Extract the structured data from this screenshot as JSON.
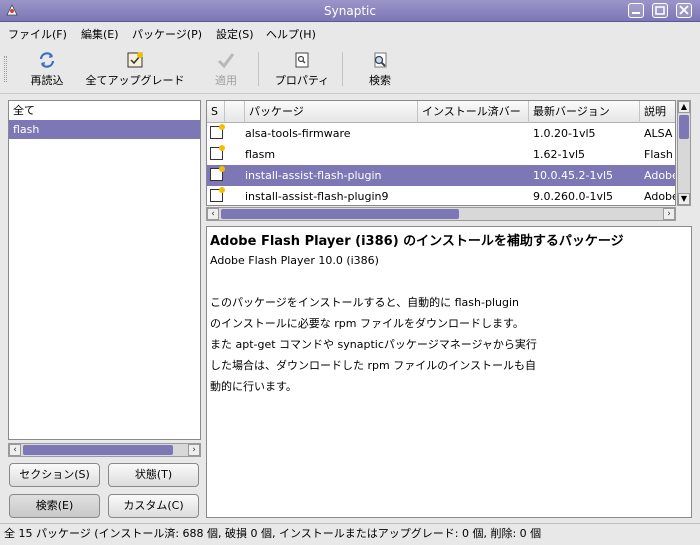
{
  "window": {
    "title": "Synaptic"
  },
  "menu": [
    "ファイル(F)",
    "編集(E)",
    "パッケージ(P)",
    "設定(S)",
    "ヘルプ(H)"
  ],
  "toolbar": {
    "reload": "再読込",
    "upgrade_all": "全てアップグレード",
    "apply": "適用",
    "properties": "プロパティ",
    "search": "検索"
  },
  "filter_list": [
    {
      "label": "全て",
      "selected": false
    },
    {
      "label": "flash",
      "selected": true
    }
  ],
  "filter_buttons": {
    "sections": "セクション(S)",
    "status": "状態(T)",
    "search": "検索(E)",
    "custom": "カスタム(C)"
  },
  "table": {
    "headers": [
      "S",
      "パッケージ",
      "インストール済バー",
      "最新バージョン",
      "説明"
    ],
    "rows": [
      {
        "name": "alsa-tools-firmware",
        "installed": "",
        "latest": "1.0.20-1vl5",
        "desc": "ALSA",
        "selected": false
      },
      {
        "name": "flasm",
        "installed": "",
        "latest": "1.62-1vl5",
        "desc": "Flash",
        "selected": false
      },
      {
        "name": "install-assist-flash-plugin",
        "installed": "",
        "latest": "10.0.45.2-1vl5",
        "desc": "Adobe",
        "selected": true
      },
      {
        "name": "install-assist-flash-plugin9",
        "installed": "",
        "latest": "9.0.260.0-1vl5",
        "desc": "Adobe",
        "selected": false
      }
    ]
  },
  "description": {
    "title": "Adobe Flash Player (i386) のインストールを補助するパッケージ",
    "subtitle": "Adobe Flash Player 10.0 (i386)",
    "lines": [
      "",
      "このパッケージをインストールすると、自動的に flash-plugin",
      "のインストールに必要な rpm ファイルをダウンロードします。",
      "また apt-get コマンドや synapticパッケージマネージャから実行",
      "した場合は、ダウンロードした rpm ファイルのインストールも自",
      "動的に行います。"
    ]
  },
  "status_bar": "全 15 パッケージ (インストール済: 688 個, 破損 0 個, インストールまたはアップグレード: 0 個, 削除: 0 個"
}
